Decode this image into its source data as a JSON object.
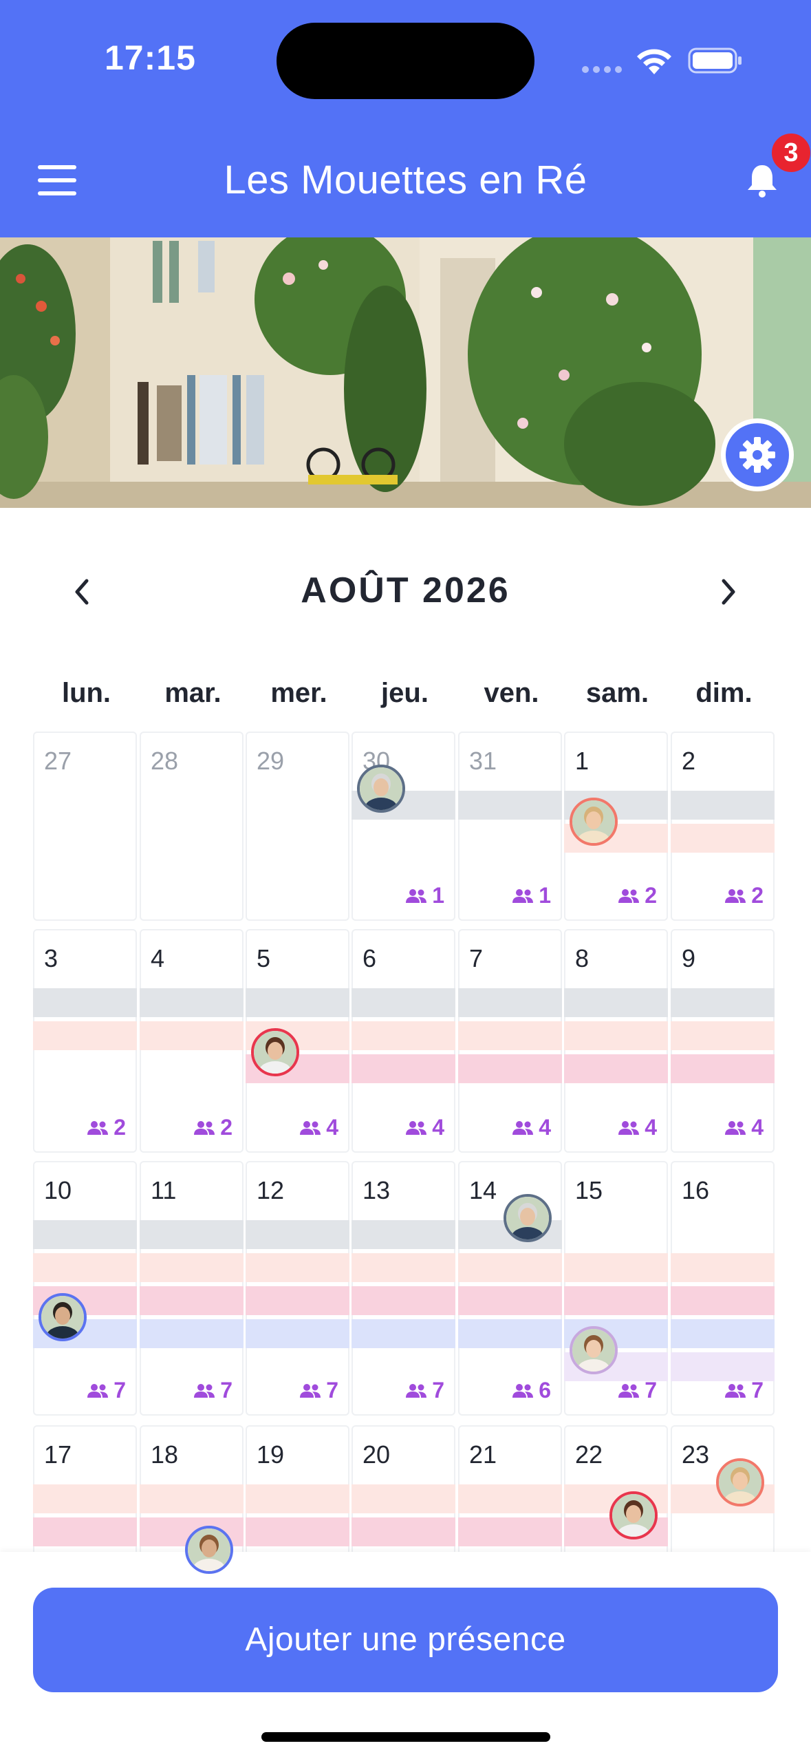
{
  "status_bar": {
    "time": "17:15"
  },
  "header": {
    "title": "Les Mouettes en Ré",
    "notification_count": "3"
  },
  "calendar": {
    "month_label": "AOÛT 2026",
    "weekdays": [
      "lun.",
      "mar.",
      "mer.",
      "jeu.",
      "ven.",
      "sam.",
      "dim."
    ],
    "weeks": [
      {
        "days": [
          {
            "n": "27",
            "muted": true,
            "count": ""
          },
          {
            "n": "28",
            "muted": true,
            "count": ""
          },
          {
            "n": "29",
            "muted": true,
            "count": ""
          },
          {
            "n": "30",
            "muted": true,
            "count": "1"
          },
          {
            "n": "31",
            "muted": true,
            "count": "1"
          },
          {
            "n": "1",
            "muted": false,
            "count": "2"
          },
          {
            "n": "2",
            "muted": false,
            "count": "2"
          }
        ]
      },
      {
        "days": [
          {
            "n": "3",
            "count": "2"
          },
          {
            "n": "4",
            "count": "2"
          },
          {
            "n": "5",
            "count": "4"
          },
          {
            "n": "6",
            "count": "4"
          },
          {
            "n": "7",
            "count": "4"
          },
          {
            "n": "8",
            "count": "4"
          },
          {
            "n": "9",
            "count": "4"
          }
        ]
      },
      {
        "days": [
          {
            "n": "10",
            "count": "7"
          },
          {
            "n": "11",
            "count": "7"
          },
          {
            "n": "12",
            "count": "7"
          },
          {
            "n": "13",
            "count": "7"
          },
          {
            "n": "14",
            "count": "6"
          },
          {
            "n": "15",
            "count": "7"
          },
          {
            "n": "16",
            "count": "7"
          }
        ]
      },
      {
        "days": [
          {
            "n": "17",
            "count": ""
          },
          {
            "n": "18",
            "count": ""
          },
          {
            "n": "19",
            "count": ""
          },
          {
            "n": "20",
            "count": ""
          },
          {
            "n": "21",
            "count": ""
          },
          {
            "n": "22",
            "count": ""
          },
          {
            "n": "23",
            "count": ""
          }
        ]
      }
    ]
  },
  "colors": {
    "primary": "#5372f6",
    "badge": "#e8242f",
    "count_text": "#a04bdc",
    "stay_gray": "#e1e4e8",
    "stay_peach": "#fde6e2",
    "stay_pink": "#f9d2de",
    "stay_blue": "#dbe2fb",
    "stay_lavender": "#efe6f9"
  },
  "actions": {
    "add_presence": "Ajouter une présence"
  }
}
